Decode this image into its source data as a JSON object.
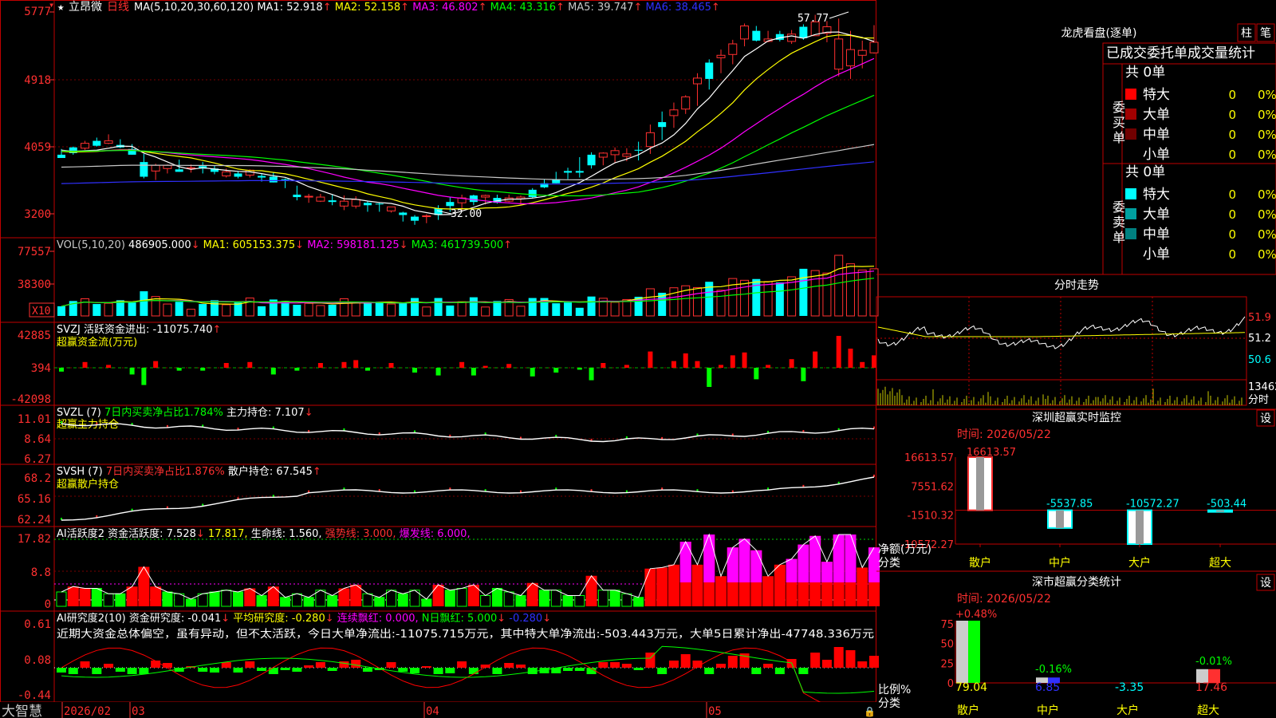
{
  "chart_data": {
    "type": "candlestick",
    "stock_name": "立昂微",
    "period_label": "日线",
    "top_left_price": "5777",
    "panes": {
      "main": {
        "yticks": [
          5777,
          4918,
          4059,
          3200
        ],
        "ma_legend": [
          {
            "label": "MA(5,10,20,30,60,120)",
            "color": "#ffffff"
          },
          {
            "label": "MA1: 52.918",
            "arrow": "↑",
            "color": "#ffffff"
          },
          {
            "label": "MA2: 52.158",
            "arrow": "↑",
            "color": "#ffff00"
          },
          {
            "label": "MA3: 46.802",
            "arrow": "↑",
            "color": "#ff00ff"
          },
          {
            "label": "MA4: 43.316",
            "arrow": "↑",
            "color": "#00ff00"
          },
          {
            "label": "MA5: 39.747",
            "arrow": "↑",
            "color": "#c8c8c8"
          },
          {
            "label": "MA6: 38.465",
            "arrow": "↑",
            "color": "#3030ff"
          }
        ],
        "high_label": "57.77",
        "low_label": "32.00",
        "candle_low": [
          40.3,
          40.6,
          41.2,
          41.6,
          41.9,
          41.4,
          40.6,
          37.7,
          37.5,
          38.3,
          38.5,
          38.4,
          38.3,
          38.2,
          37.8,
          37.7,
          37.8,
          37.3,
          37.2,
          36.5,
          35.0,
          34.7,
          34.8,
          34.4,
          33.8,
          34.0,
          33.6,
          33.6,
          33.5,
          32.4,
          32.0,
          32.2,
          32.6,
          33.6,
          33.8,
          34.4,
          34.5,
          34.6,
          34.8,
          34.4,
          35.3,
          36.5,
          37.1,
          37.6,
          37.8,
          38.9,
          39.3,
          39.6,
          39.8,
          39.9,
          40.7,
          42.4,
          43.9,
          45.6,
          46.6,
          48.6,
          50.6,
          51.7,
          53.9,
          54.5,
          54.4,
          54.5,
          54.2,
          54.7,
          55.9,
          54.4,
          50.2,
          49.9,
          51.2,
          53.0
        ],
        "candle_high": [
          41.3,
          41.6,
          42.3,
          42.7,
          43.1,
          42.5,
          41.9,
          40.7,
          39.5,
          39.4,
          40.0,
          39.4,
          39.7,
          39.3,
          38.9,
          38.6,
          38.8,
          38.3,
          38.4,
          37.7,
          36.8,
          35.8,
          35.8,
          35.7,
          35.6,
          35.5,
          34.9,
          34.7,
          34.2,
          33.6,
          33.2,
          33.3,
          34.4,
          35.4,
          35.7,
          35.7,
          35.7,
          35.7,
          35.7,
          35.6,
          36.5,
          37.6,
          38.5,
          39.0,
          40.3,
          40.9,
          40.9,
          41.5,
          41.4,
          42.2,
          44.3,
          45.9,
          47.0,
          47.9,
          50.6,
          52.3,
          53.5,
          54.7,
          56.7,
          56.4,
          55.8,
          55.8,
          55.9,
          56.6,
          57.77,
          57.0,
          57.3,
          55.8,
          54.6,
          56.5
        ],
        "candle_open": [
          40.6,
          41.5,
          41.4,
          42.3,
          42.0,
          41.8,
          41.3,
          39.7,
          38.6,
          38.9,
          38.8,
          39.0,
          39.2,
          38.9,
          38.0,
          38.3,
          38.1,
          38.0,
          37.9,
          37.6,
          35.7,
          35.4,
          34.9,
          35.0,
          34.3,
          34.3,
          34.7,
          34.6,
          33.7,
          33.5,
          33.0,
          33.1,
          34.0,
          34.8,
          34.7,
          35.6,
          35.4,
          35.3,
          34.9,
          35.2,
          36.3,
          37.1,
          37.6,
          38.6,
          38.6,
          40.6,
          40.3,
          40.6,
          40.4,
          41.2,
          41.6,
          44.6,
          45.4,
          46.2,
          49.3,
          51.9,
          52.5,
          52.9,
          54.8,
          55.8,
          54.5,
          55.4,
          54.5,
          56.3,
          55.2,
          55.5,
          51.1,
          51.5,
          52.8,
          53.1
        ],
        "candle_close": [
          40.2,
          40.8,
          42.0,
          41.7,
          42.3,
          41.5,
          40.6,
          37.9,
          39.3,
          39.3,
          38.5,
          39.0,
          38.9,
          38.5,
          38.5,
          37.9,
          38.7,
          37.8,
          37.2,
          37.5,
          35.4,
          35.5,
          35.4,
          34.8,
          34.9,
          35.1,
          34.4,
          34.5,
          34.2,
          33.2,
          32.5,
          33.1,
          33.2,
          34.3,
          35.3,
          34.8,
          35.6,
          34.7,
          35.3,
          35.4,
          35.4,
          36.6,
          37.1,
          38.4,
          38.4,
          39.3,
          40.8,
          41.1,
          40.7,
          41.1,
          43.3,
          44.0,
          46.1,
          47.7,
          50.0,
          49.9,
          52.8,
          54.2,
          56.4,
          54.6,
          54.8,
          54.7,
          55.4,
          54.9,
          56.9,
          56.3,
          54.8,
          53.5,
          53.4,
          54.4
        ]
      },
      "volume": {
        "yticks": [
          77557,
          38300
        ],
        "unit_badge": "X10",
        "legend": [
          {
            "label": "VOL(5,10,20)",
            "color": "#c8c8c8"
          },
          {
            "label": "486905.000",
            "arrow": "↓",
            "color": "#ffffff"
          },
          {
            "label": "MA1: 605153.375",
            "arrow": "↓",
            "color": "#ffff00"
          },
          {
            "label": "MA2: 598181.125",
            "arrow": "↓",
            "color": "#ff00ff"
          },
          {
            "label": "MA3: 461739.500",
            "arrow": "↑",
            "color": "#00ff00"
          }
        ]
      },
      "svzj": {
        "yticks": [
          42885,
          394,
          -42098
        ],
        "legend": [
          {
            "label": "SVZJ  活跃资金进出: -11075.740",
            "arrow": "↑",
            "color": "#ffffff"
          }
        ],
        "subtitle": "超赢资金流(万元)"
      },
      "svzl": {
        "yticks": [
          11.01,
          8.64,
          6.27
        ],
        "legend": [
          {
            "label": "SVZL (7)",
            "color": "#ffffff"
          },
          {
            "label": "7日内买卖净占比1.784%",
            "color": "#00ff00"
          },
          {
            "label": "主力持仓: 7.107",
            "arrow": "↓",
            "color": "#ffffff"
          }
        ],
        "subtitle": "超赢主力持仓"
      },
      "svsh": {
        "yticks": [
          68.2,
          65.16,
          62.24
        ],
        "legend": [
          {
            "label": "SVSH (7)",
            "color": "#ffffff"
          },
          {
            "label": "7日内买卖净占比1.876%",
            "color": "#ff3030"
          },
          {
            "label": "散户持仓: 67.545",
            "arrow": "↑",
            "color": "#ffffff"
          }
        ],
        "subtitle": "超赢散户持仓"
      },
      "ai_activity": {
        "yticks": [
          17.82,
          8.8,
          0.0
        ],
        "legend": [
          {
            "label": "AI活跃度2",
            "color": "#ffffff"
          },
          {
            "label": "资金活跃度: 7.528",
            "arrow": "↓",
            "color": "#ffffff"
          },
          {
            "label": "17.817,",
            "color": "#ffff00"
          },
          {
            "label": "生命线: 1.560,",
            "color": "#ffffff"
          },
          {
            "label": "强势线: 3.000,",
            "color": "#ff3030"
          },
          {
            "label": "爆发线: 6.000,",
            "color": "#ff00ff"
          }
        ]
      },
      "ai_research": {
        "yticks": [
          0.61,
          0.08,
          -0.44
        ],
        "legend": [
          {
            "label": "AI研究度2(10)",
            "color": "#ffffff"
          },
          {
            "label": "资金研究度: -0.041",
            "arrow": "↓",
            "color": "#ffffff"
          },
          {
            "label": "平均研究度: -0.280",
            "arrow": "↓",
            "color": "#ffff00"
          },
          {
            "label": "连续飘红: 0.000,",
            "color": "#ff00ff"
          },
          {
            "label": "N日飘红: 5.000",
            "arrow": "↓",
            "color": "#00ff00"
          },
          {
            "label": "-0.280",
            "arrow": "↓",
            "color": "#3030ff"
          }
        ],
        "comment": "近期大资金总体偏空，虽有异动，但不太活跃，今日大单净流出:-11075.715万元，其中特大单净流出:-503.443万元，大单5日累计净出-47748.336万元"
      }
    },
    "x_labels": [
      "2026/02",
      "03",
      "04",
      "05"
    ],
    "watermark": "大智慧"
  },
  "right_panel": {
    "title": "龙虎看盘(逐单)",
    "btn1": "柱",
    "btn2": "笔",
    "header": "已成交委托单成交量统计",
    "buy_label": "委买单",
    "sell_label": "委卖单",
    "buy_total": "共 0单",
    "sell_total": "共 0单",
    "sizes": [
      "特大",
      "大单",
      "中单",
      "小单"
    ],
    "buy_colors": [
      "#ff0000",
      "#a00000",
      "#700000",
      ""
    ],
    "sell_colors": [
      "#00ffff",
      "#00a0a0",
      "#008080",
      ""
    ],
    "count": "0",
    "pct": "0%",
    "intraday_title": "分时走势",
    "intraday_ticks": [
      "51.9",
      "51.2",
      "50.6",
      "13462",
      "分时"
    ],
    "monitor_title": "深圳超赢实时监控",
    "monitor_btn": "设",
    "time_label": "时间: 2026/05/22",
    "monitor_ticks": [
      "16613.57",
      "7551.62",
      "-1510.32",
      "-10572.27"
    ],
    "monitor_axis_title": "净额(万元)",
    "monitor_axis_sub": "分类",
    "monitor_values": [
      16613.57,
      -5537.85,
      -10572.27,
      -503.44
    ],
    "monitor_value_labels": [
      "16613.57",
      "-5537.85",
      "-10572.27",
      "-503.44"
    ],
    "categories": [
      "散户",
      "中户",
      "大户",
      "超大"
    ],
    "stats_title": "深市超赢分类统计",
    "stats_btn": "设",
    "stats_ticks": [
      "75",
      "50",
      "25",
      "0"
    ],
    "stats_axis_title": "比例%",
    "stats_axis_sub": "分类",
    "stats_top_labels": [
      "+0.48%",
      "-0.16%",
      "",
      "-0.01%"
    ],
    "stats_values": [
      79.04,
      6.85,
      -3.35,
      17.46
    ],
    "stats_value_labels": [
      "79.04",
      "6.85",
      "-3.35",
      "17.46"
    ]
  }
}
